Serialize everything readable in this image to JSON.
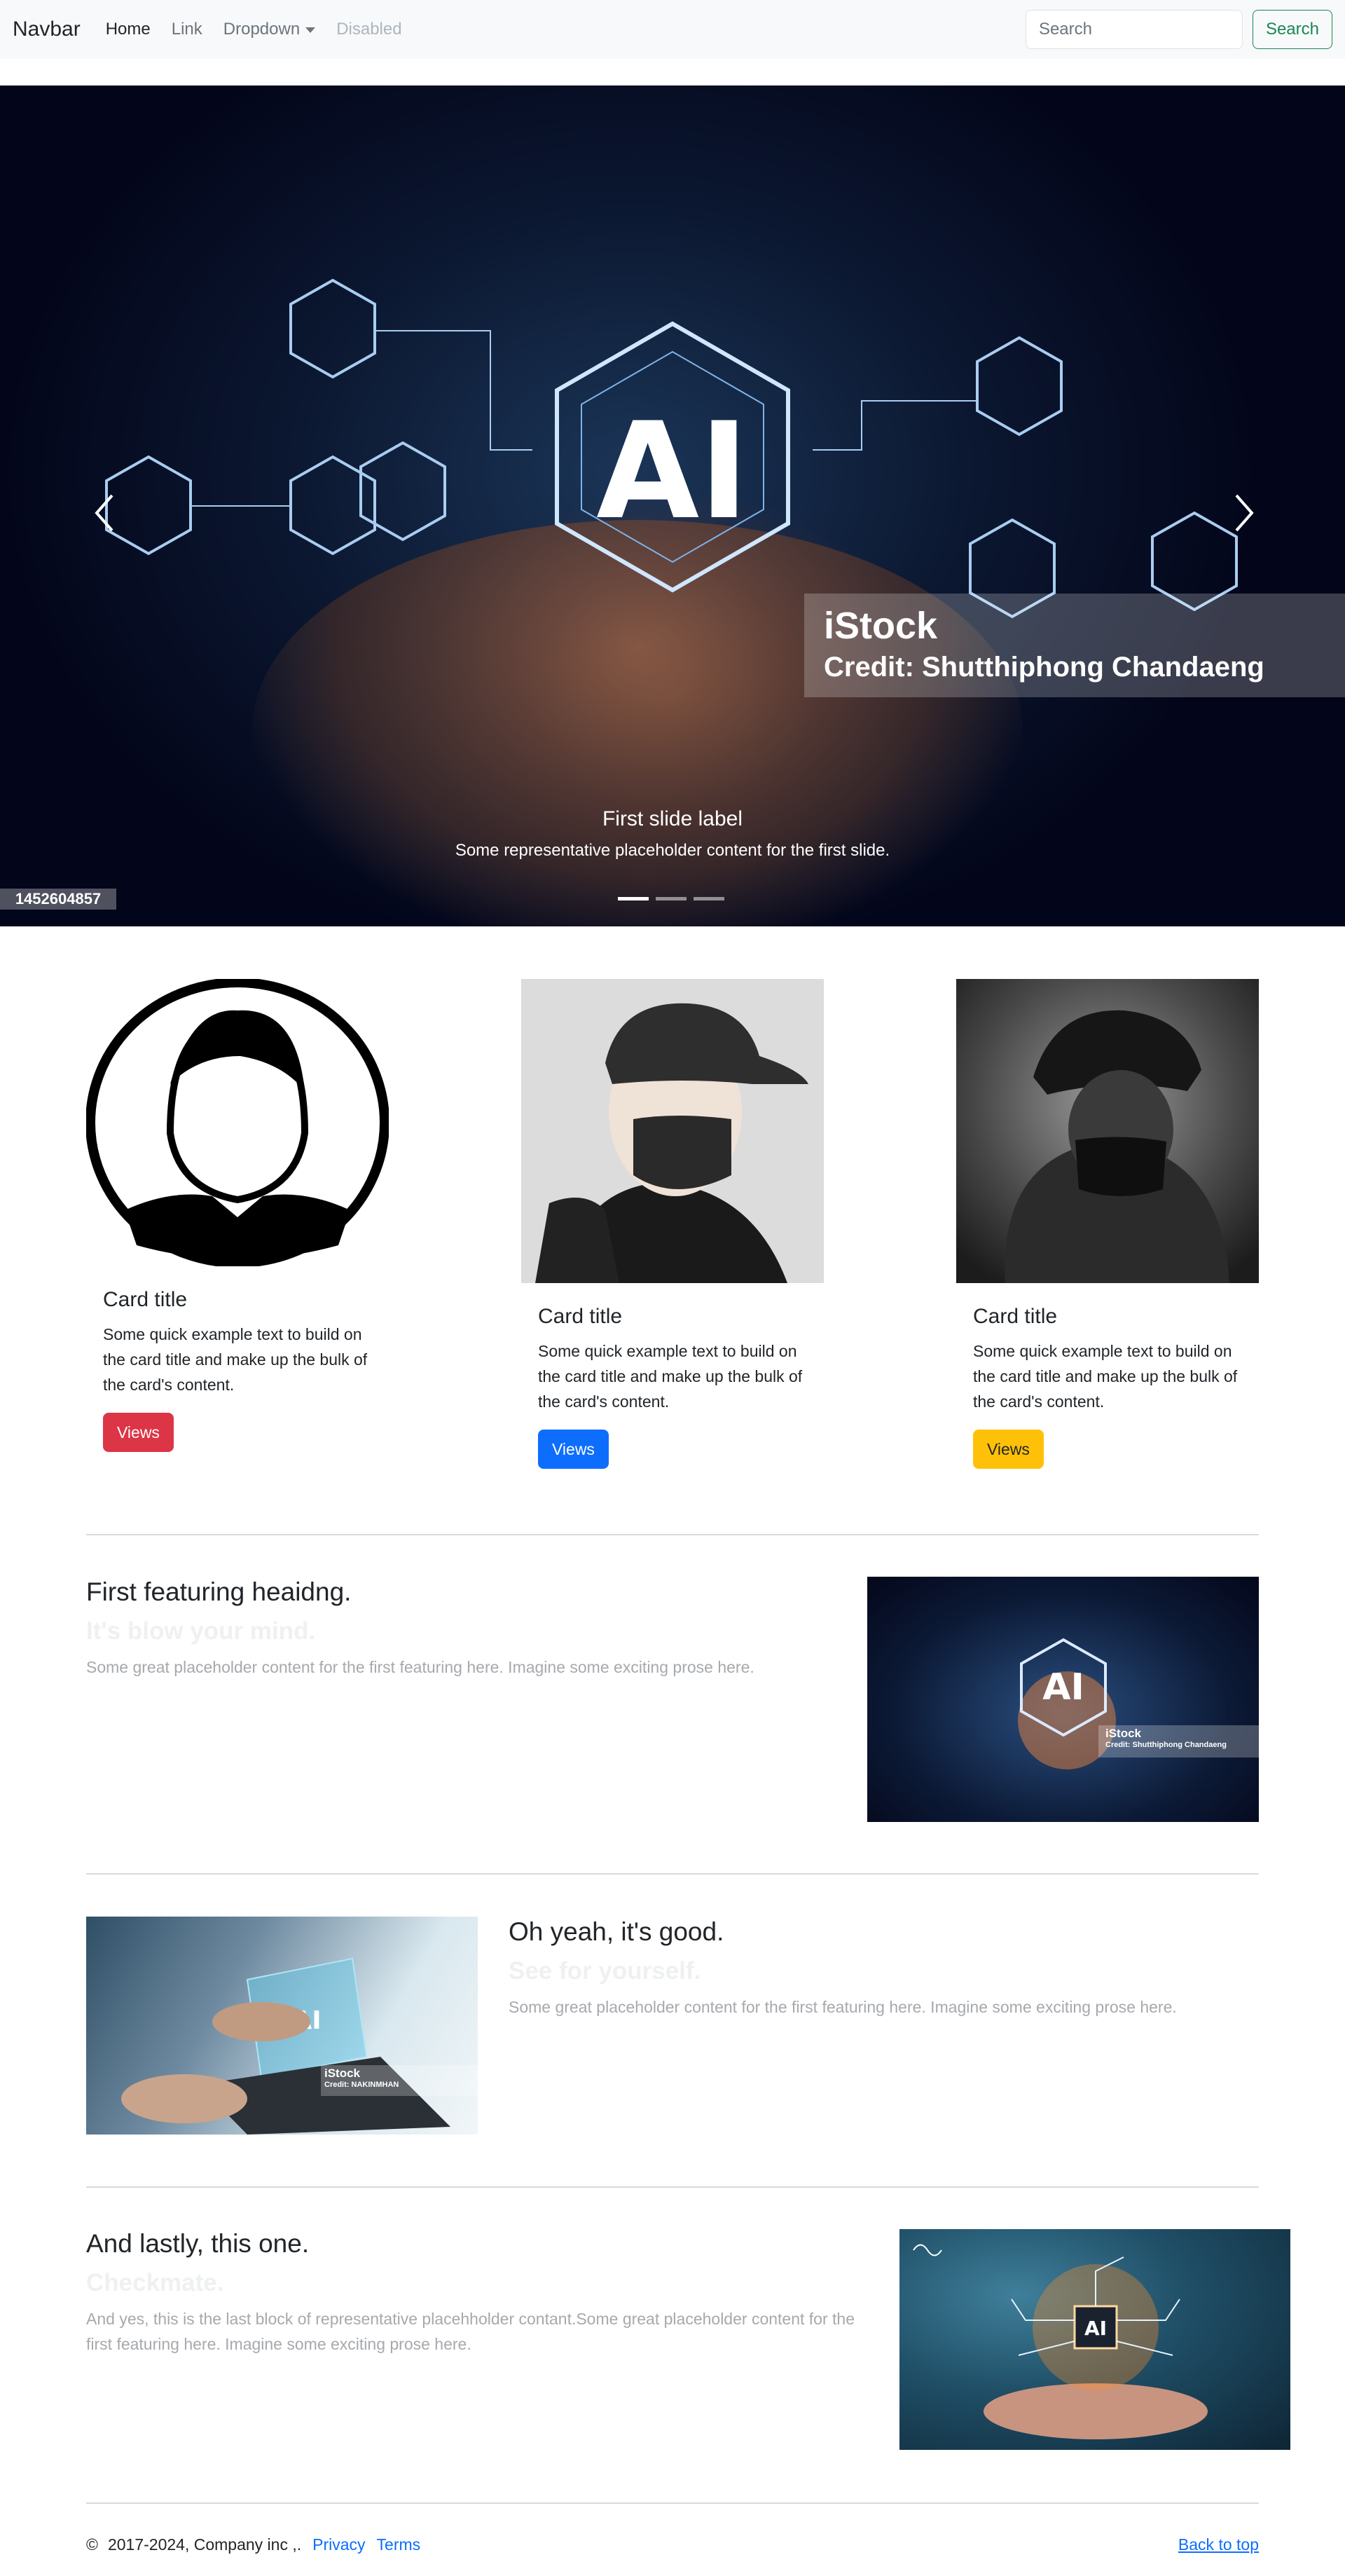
{
  "navbar": {
    "brand": "Navbar",
    "links": [
      "Home",
      "Link",
      "Dropdown",
      "Disabled"
    ],
    "search_placeholder": "Search",
    "search_button": "Search"
  },
  "carousel": {
    "watermark_logo": "iStock",
    "watermark_credit": "Credit: Shutthiphong Chandaeng",
    "stock_id": "1452604857",
    "ai_text": "AI",
    "caption_title": "First slide label",
    "caption_text": "Some representative placeholder content for the first slide.",
    "indicator_count": 3,
    "active_indicator": 1
  },
  "cards": [
    {
      "title": "Card title",
      "text": "Some quick example text to build on the card title and make up the bulk of the card's content.",
      "button": "Views",
      "button_color": "#dc3545"
    },
    {
      "title": "Card title",
      "text": "Some quick example text to build on the card title and make up the bulk of the card's content.",
      "button": "Views",
      "button_color": "#0d6efd"
    },
    {
      "title": "Card title",
      "text": "Some quick example text to build on the card title and make up the bulk of the card's content.",
      "button": "Views",
      "button_color": "#ffc107"
    }
  ],
  "features": [
    {
      "heading": "First featuring heaidng.",
      "sub": "It's blow your mind.",
      "text": "Some great placeholder content for the first featuring here. Imagine some exciting prose here.",
      "img_logo": "iStock",
      "img_credit": "Credit: Shutthiphong Chandaeng"
    },
    {
      "heading": "Oh yeah, it's good.",
      "sub": "See for yourself.",
      "text": "Some great placeholder content for the first featuring here. Imagine some exciting prose here.",
      "img_logo": "iStock",
      "img_credit": "Credit: NAKINMHAN"
    },
    {
      "heading": "And lastly, this one.",
      "sub": "Checkmate.",
      "text": "And yes, this is the last block of representative placehholder contant.Some great placeholder content for the first featuring here. Imagine some exciting prose here."
    }
  ],
  "footer": {
    "copyright_symbol": "©",
    "copyright": "2017-2024, Company inc ,.",
    "privacy": "Privacy",
    "terms": "Terms",
    "back_to_top": "Back to top"
  },
  "colors": {
    "navbar_bg": "#f8f9fa",
    "search_button": "#198754",
    "link": "#0d6efd"
  }
}
